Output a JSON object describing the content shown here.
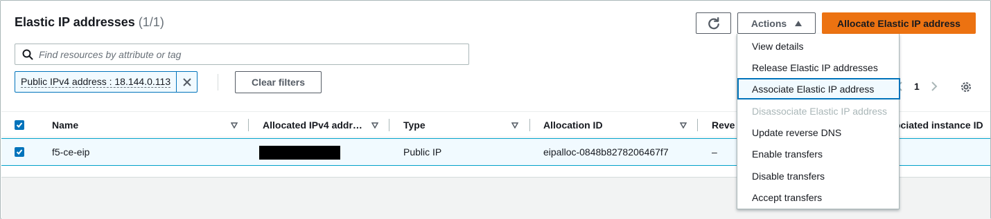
{
  "header": {
    "title": "Elastic IP addresses",
    "count": "(1/1)",
    "refresh_icon": "refresh-icon",
    "actions_label": "Actions",
    "allocate_label": "Allocate Elastic IP address"
  },
  "search": {
    "placeholder": "Find resources by attribute or tag",
    "value": ""
  },
  "filter": {
    "token": "Public IPv4 address : 18.144.0.113",
    "clear_label": "Clear filters"
  },
  "pagination": {
    "page": "1"
  },
  "table": {
    "columns": [
      "Name",
      "Allocated IPv4 addr…",
      "Type",
      "Allocation ID",
      "Reve",
      "ociated instance ID"
    ],
    "rows": [
      {
        "selected": true,
        "name": "f5-ce-eip",
        "allocated_ipv4": "",
        "type": "Public IP",
        "allocation_id": "eipalloc-0848b8278206467f7",
        "reverse_dns": "–"
      }
    ]
  },
  "actions_menu": {
    "items": [
      {
        "label": "View details",
        "state": "normal"
      },
      {
        "label": "Release Elastic IP addresses",
        "state": "normal"
      },
      {
        "label": "Associate Elastic IP address",
        "state": "active"
      },
      {
        "label": "Disassociate Elastic IP address",
        "state": "disabled"
      },
      {
        "label": "Update reverse DNS",
        "state": "normal"
      },
      {
        "label": "Enable transfers",
        "state": "normal"
      },
      {
        "label": "Disable transfers",
        "state": "normal"
      },
      {
        "label": "Accept transfers",
        "state": "normal"
      }
    ]
  },
  "colors": {
    "primary": "#ec7211",
    "accent": "#0073bb",
    "selected_row_bg": "#f1faff"
  }
}
